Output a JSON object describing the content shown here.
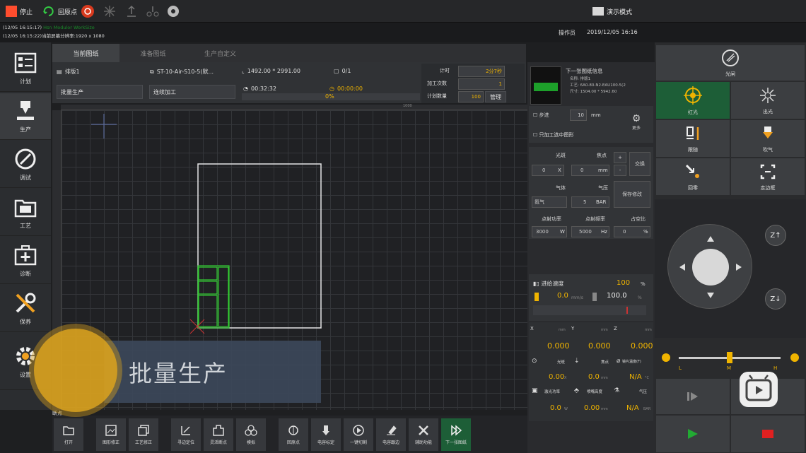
{
  "topbar": {
    "stop_label": "停止",
    "origin_label": "回原点",
    "mode_label": "演示模式"
  },
  "statusbar": {
    "log_line_1": "(12/05 16:15:17)",
    "log_line_1_green": "Hsn Modulor WorkSize",
    "log_line_2": "(12/05 16:15:22)当前屏幕分辨率:1920 x 1080",
    "operator": "操作员",
    "datetime": "2019/12/05 16:16"
  },
  "sidebar": {
    "items": [
      {
        "label": "计划",
        "icon": "plan-icon"
      },
      {
        "label": "生产",
        "icon": "production-icon"
      },
      {
        "label": "调试",
        "icon": "debug-icon"
      },
      {
        "label": "工艺",
        "icon": "process-icon"
      },
      {
        "label": "诊断",
        "icon": "diagnosis-icon"
      },
      {
        "label": "保养",
        "icon": "maintenance-icon"
      },
      {
        "label": "设置",
        "icon": "settings-icon"
      }
    ]
  },
  "tabs": [
    "当前图纸",
    "准备图纸",
    "生产自定义"
  ],
  "info": {
    "layout": "排版1",
    "file": "ST-10-Air-S10-5(默...",
    "size": "1492.00 * 2991.00",
    "count": "0/1",
    "mode_select": "批量生产",
    "process_select": "连续加工",
    "time1": "00:32:32",
    "time2": "00:00:00",
    "progress_pct": "0%",
    "progress": 0,
    "timer_label": "计时",
    "timer_value": "2分7秒",
    "proc_count_label": "加工次数",
    "proc_count_value": "1",
    "plan_qty_label": "计划数量",
    "plan_qty_value": "100",
    "manage_label": "管理"
  },
  "ruler": {
    "tick": "1000"
  },
  "next_sheet": {
    "title": "下一张图纸信息",
    "name_label": "名称:",
    "name_value": "排版1",
    "process_label": "工艺:",
    "process_value": "6A0-80-N2-EAU100-5(2",
    "size_label": "尺寸:",
    "size_value": "1504.00 * 5942.60"
  },
  "params": {
    "step_label": "步进",
    "step_value": "10",
    "step_unit": "mm",
    "only_label": "只加工选中图形",
    "more_label": "更多",
    "light_label": "光斑",
    "light_value": "0",
    "light_unit": "X",
    "focus_label": "焦点",
    "focus_value": "0",
    "focus_unit": "mm",
    "swap_label": "交换",
    "gas_label": "气体",
    "gas_value": "氮气",
    "pressure_label": "气压",
    "pressure_value": "5",
    "pressure_unit": "BAR",
    "blow_label": "保存修改",
    "power_label": "点射功率",
    "power_value": "3000",
    "power_unit": "W",
    "freq_label": "点射频率",
    "freq_value": "5000",
    "freq_unit": "Hz",
    "duty_label": "占空比",
    "duty_value": "0",
    "duty_unit": "%",
    "feed_label": "进给速度",
    "feed_pct": "100",
    "feed_unit": "%",
    "speed_value": "0.0",
    "speed_unit": "mm/s",
    "override_value": "100.0",
    "override_unit": "%"
  },
  "coords": {
    "x_label": "X",
    "y_label": "Y",
    "z_label": "Z",
    "unit": "mm",
    "x": "0.000",
    "y": "0.000",
    "z": "0.000",
    "spot_label": "光斑",
    "spot_value": "0.00",
    "spot_unit": "X",
    "focus_label": "焦点",
    "focus_value": "0.0",
    "focus_unit": "mm",
    "temp_label": "镜片温度(F)",
    "temp_value": "N/A",
    "temp_unit": "°C",
    "laser_power_label": "激光功率",
    "laser_power_value": "0.0",
    "laser_power_unit": "W",
    "nozzle_label": "喷嘴高度",
    "nozzle_value": "0.00",
    "nozzle_unit": "mm",
    "gas_label": "气压",
    "gas_value": "N/A",
    "gas_unit": "BAR"
  },
  "right": {
    "shutter_label": "光闸",
    "red_light_label": "红光",
    "laser_out_label": "出光",
    "follow_label": "跟随",
    "blow_label": "吹气",
    "return_label": "回零",
    "border_label": "走边框",
    "zup_label": "Z↑",
    "zdown_label": "Z↓",
    "speed_low": "L",
    "speed_mid": "M",
    "speed_high": "H",
    "speed_level": 0.5
  },
  "toolbar": [
    {
      "label": "打开",
      "icon": "folder-icon"
    },
    {
      "label": "图形修正",
      "icon": "image-edit-icon"
    },
    {
      "label": "工艺修正",
      "icon": "layers-icon"
    },
    {
      "label": "寻边定位",
      "icon": "edge-find-icon"
    },
    {
      "label": "灵活断点",
      "icon": "breakpoint-icon"
    },
    {
      "label": "模拟",
      "icon": "simulate-icon"
    },
    {
      "label": "回原点",
      "icon": "home-icon"
    },
    {
      "label": "电容标定",
      "icon": "calibrate-icon"
    },
    {
      "label": "一键切割",
      "icon": "play-circle-icon"
    },
    {
      "label": "电容跟边",
      "icon": "trace-icon"
    },
    {
      "label": "辅助功能",
      "icon": "tools-icon"
    },
    {
      "label": "下一张图纸",
      "icon": "next-sheet-icon"
    }
  ],
  "toolbar_header": "断点",
  "overlay": {
    "label": "批量生产"
  },
  "colors": {
    "accent_green": "#1d5e37",
    "value_yellow": "#f0b400",
    "drawing_green": "#33cc33",
    "stop_red": "#e02020",
    "go_green": "#22aa33"
  }
}
